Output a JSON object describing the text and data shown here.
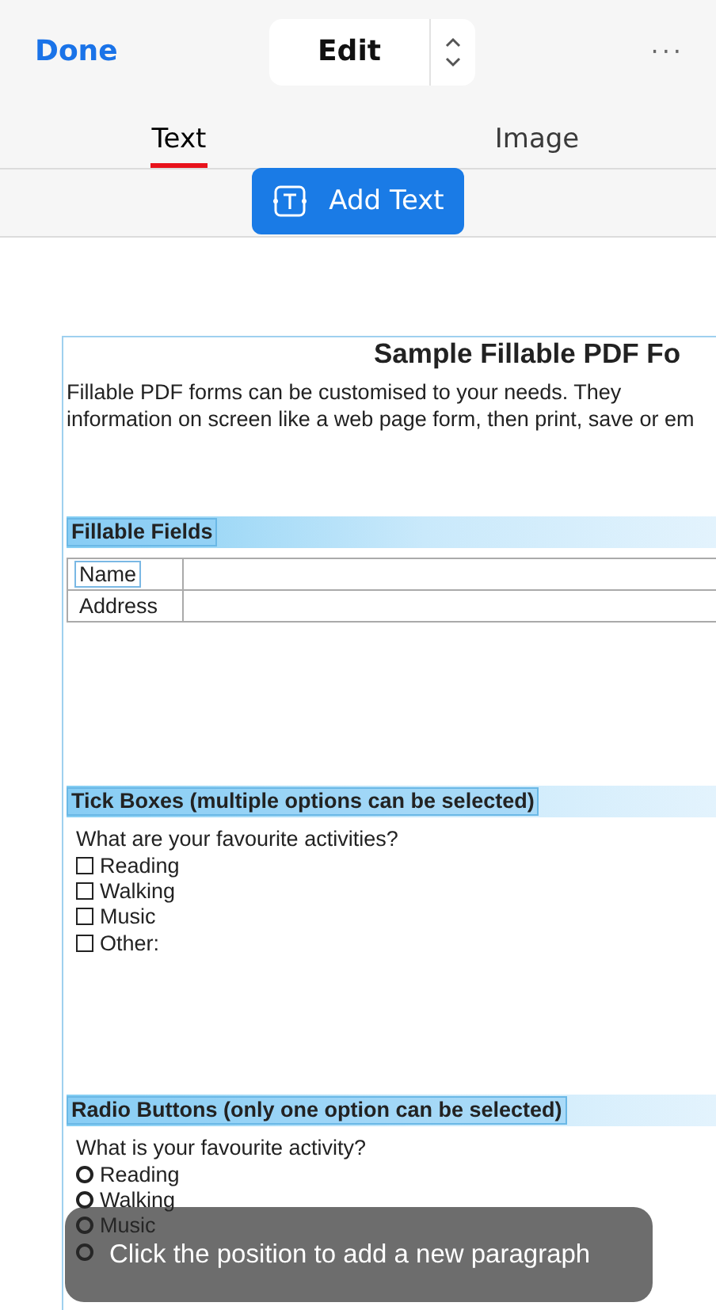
{
  "header": {
    "done": "Done",
    "mode": "Edit",
    "more": "···"
  },
  "tabs": [
    {
      "label": "Text",
      "selected": true
    },
    {
      "label": "Image",
      "selected": false
    }
  ],
  "toolbar": {
    "add_text": "Add Text"
  },
  "document": {
    "title": "Sample Fillable PDF Fo",
    "intro": [
      "Fillable PDF forms can be customised to your needs. They",
      "information on screen like a web page form, then print, save or em"
    ],
    "fields_heading": "Fillable Fields",
    "fields": [
      {
        "label": "Name",
        "focused": true
      },
      {
        "label": "Address",
        "focused": false
      }
    ],
    "tick_heading": "Tick Boxes (multiple options can be selected)",
    "tick_question": "What are your favourite activities?",
    "ticks": [
      {
        "label": "Reading",
        "checked": false
      },
      {
        "label": "Walking",
        "checked": false
      },
      {
        "label": "Music",
        "checked": false
      },
      {
        "label": "Other:",
        "checked": false
      }
    ],
    "radio_heading": "Radio Buttons (only one option can be selected)",
    "radio_question": "What is your favourite activity?",
    "radios": [
      {
        "label": "Reading",
        "selected": false
      },
      {
        "label": "Walking",
        "selected": false
      },
      {
        "label": "Music",
        "selected": false
      },
      {
        "selected": false
      }
    ]
  },
  "toast": "Click the position to add a new paragraph"
}
